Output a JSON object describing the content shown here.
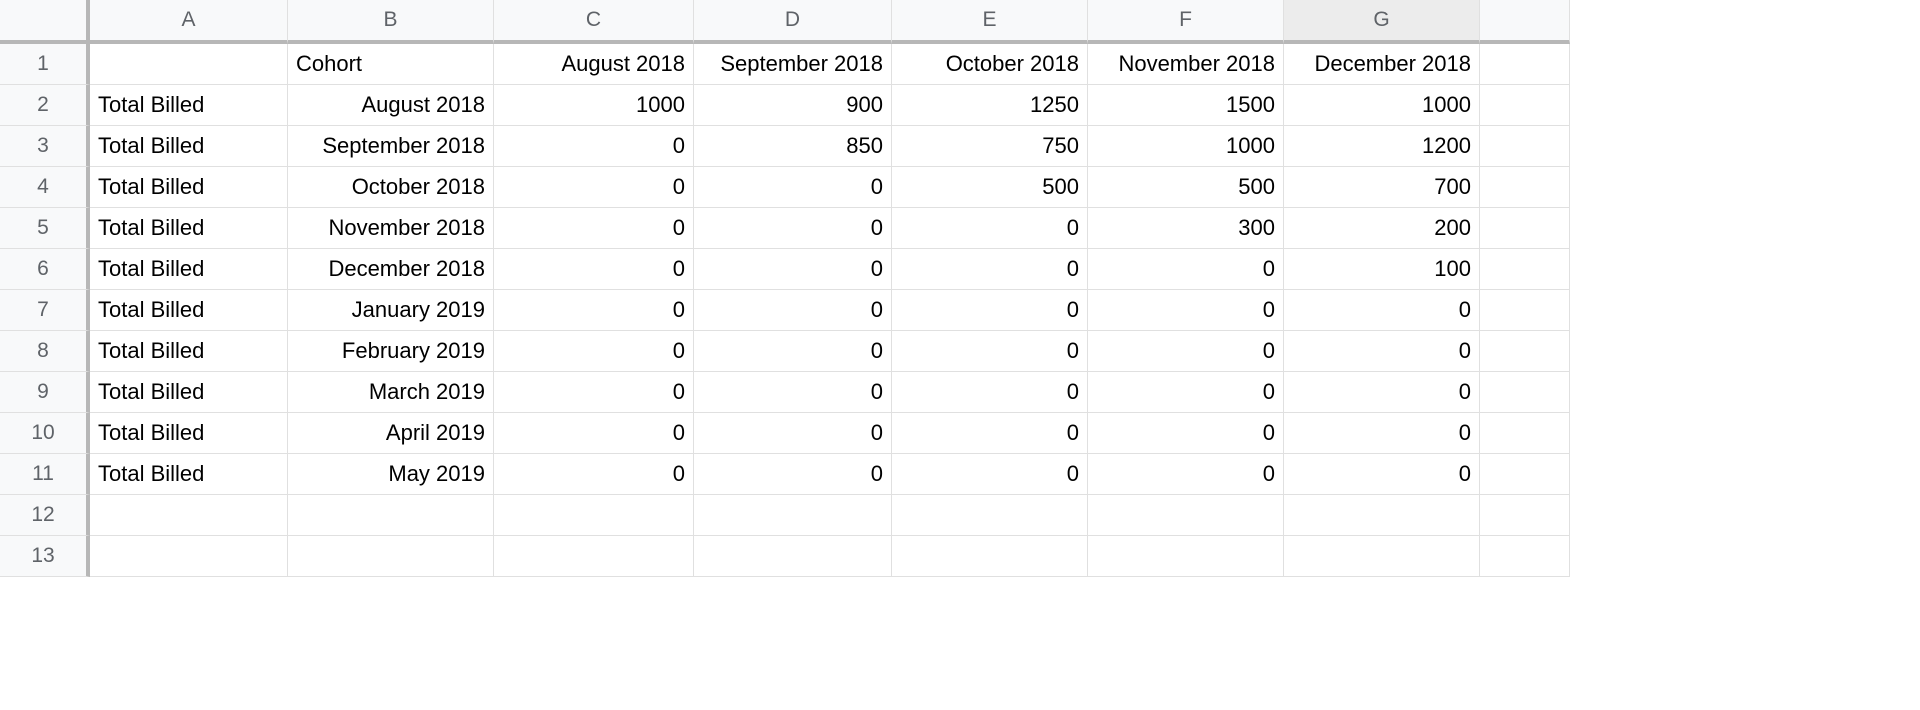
{
  "columns": [
    "A",
    "B",
    "C",
    "D",
    "E",
    "F",
    "G",
    ""
  ],
  "selected_column_index": 6,
  "row_headers": [
    "1",
    "2",
    "3",
    "4",
    "5",
    "6",
    "7",
    "8",
    "9",
    "10",
    "11",
    "12",
    "13"
  ],
  "header_row": {
    "A": "",
    "B": "Cohort",
    "C": "August 2018",
    "D": "September 2018",
    "E": "October 2018",
    "F": "November 2018",
    "G": "December 2018"
  },
  "data_rows": [
    {
      "A": "Total Billed",
      "B": "August 2018",
      "C": 1000,
      "D": 900,
      "E": 1250,
      "F": 1500,
      "G": 1000
    },
    {
      "A": "Total Billed",
      "B": "September 2018",
      "C": 0,
      "D": 850,
      "E": 750,
      "F": 1000,
      "G": 1200
    },
    {
      "A": "Total Billed",
      "B": "October 2018",
      "C": 0,
      "D": 0,
      "E": 500,
      "F": 500,
      "G": 700
    },
    {
      "A": "Total Billed",
      "B": "November 2018",
      "C": 0,
      "D": 0,
      "E": 0,
      "F": 300,
      "G": 200
    },
    {
      "A": "Total Billed",
      "B": "December 2018",
      "C": 0,
      "D": 0,
      "E": 0,
      "F": 0,
      "G": 100
    },
    {
      "A": "Total Billed",
      "B": "January 2019",
      "C": 0,
      "D": 0,
      "E": 0,
      "F": 0,
      "G": 0
    },
    {
      "A": "Total Billed",
      "B": "February 2019",
      "C": 0,
      "D": 0,
      "E": 0,
      "F": 0,
      "G": 0
    },
    {
      "A": "Total Billed",
      "B": "March 2019",
      "C": 0,
      "D": 0,
      "E": 0,
      "F": 0,
      "G": 0
    },
    {
      "A": "Total Billed",
      "B": "April 2019",
      "C": 0,
      "D": 0,
      "E": 0,
      "F": 0,
      "G": 0
    },
    {
      "A": "Total Billed",
      "B": "May 2019",
      "C": 0,
      "D": 0,
      "E": 0,
      "F": 0,
      "G": 0
    }
  ],
  "empty_rows": 2,
  "chart_data": {
    "type": "table",
    "title": "Total Billed by Cohort",
    "columns": [
      "August 2018",
      "September 2018",
      "October 2018",
      "November 2018",
      "December 2018"
    ],
    "rows": [
      {
        "cohort": "August 2018",
        "values": [
          1000,
          900,
          1250,
          1500,
          1000
        ]
      },
      {
        "cohort": "September 2018",
        "values": [
          0,
          850,
          750,
          1000,
          1200
        ]
      },
      {
        "cohort": "October 2018",
        "values": [
          0,
          0,
          500,
          500,
          700
        ]
      },
      {
        "cohort": "November 2018",
        "values": [
          0,
          0,
          0,
          300,
          200
        ]
      },
      {
        "cohort": "December 2018",
        "values": [
          0,
          0,
          0,
          0,
          100
        ]
      },
      {
        "cohort": "January 2019",
        "values": [
          0,
          0,
          0,
          0,
          0
        ]
      },
      {
        "cohort": "February 2019",
        "values": [
          0,
          0,
          0,
          0,
          0
        ]
      },
      {
        "cohort": "March 2019",
        "values": [
          0,
          0,
          0,
          0,
          0
        ]
      },
      {
        "cohort": "April 2019",
        "values": [
          0,
          0,
          0,
          0,
          0
        ]
      },
      {
        "cohort": "May 2019",
        "values": [
          0,
          0,
          0,
          0,
          0
        ]
      }
    ]
  }
}
